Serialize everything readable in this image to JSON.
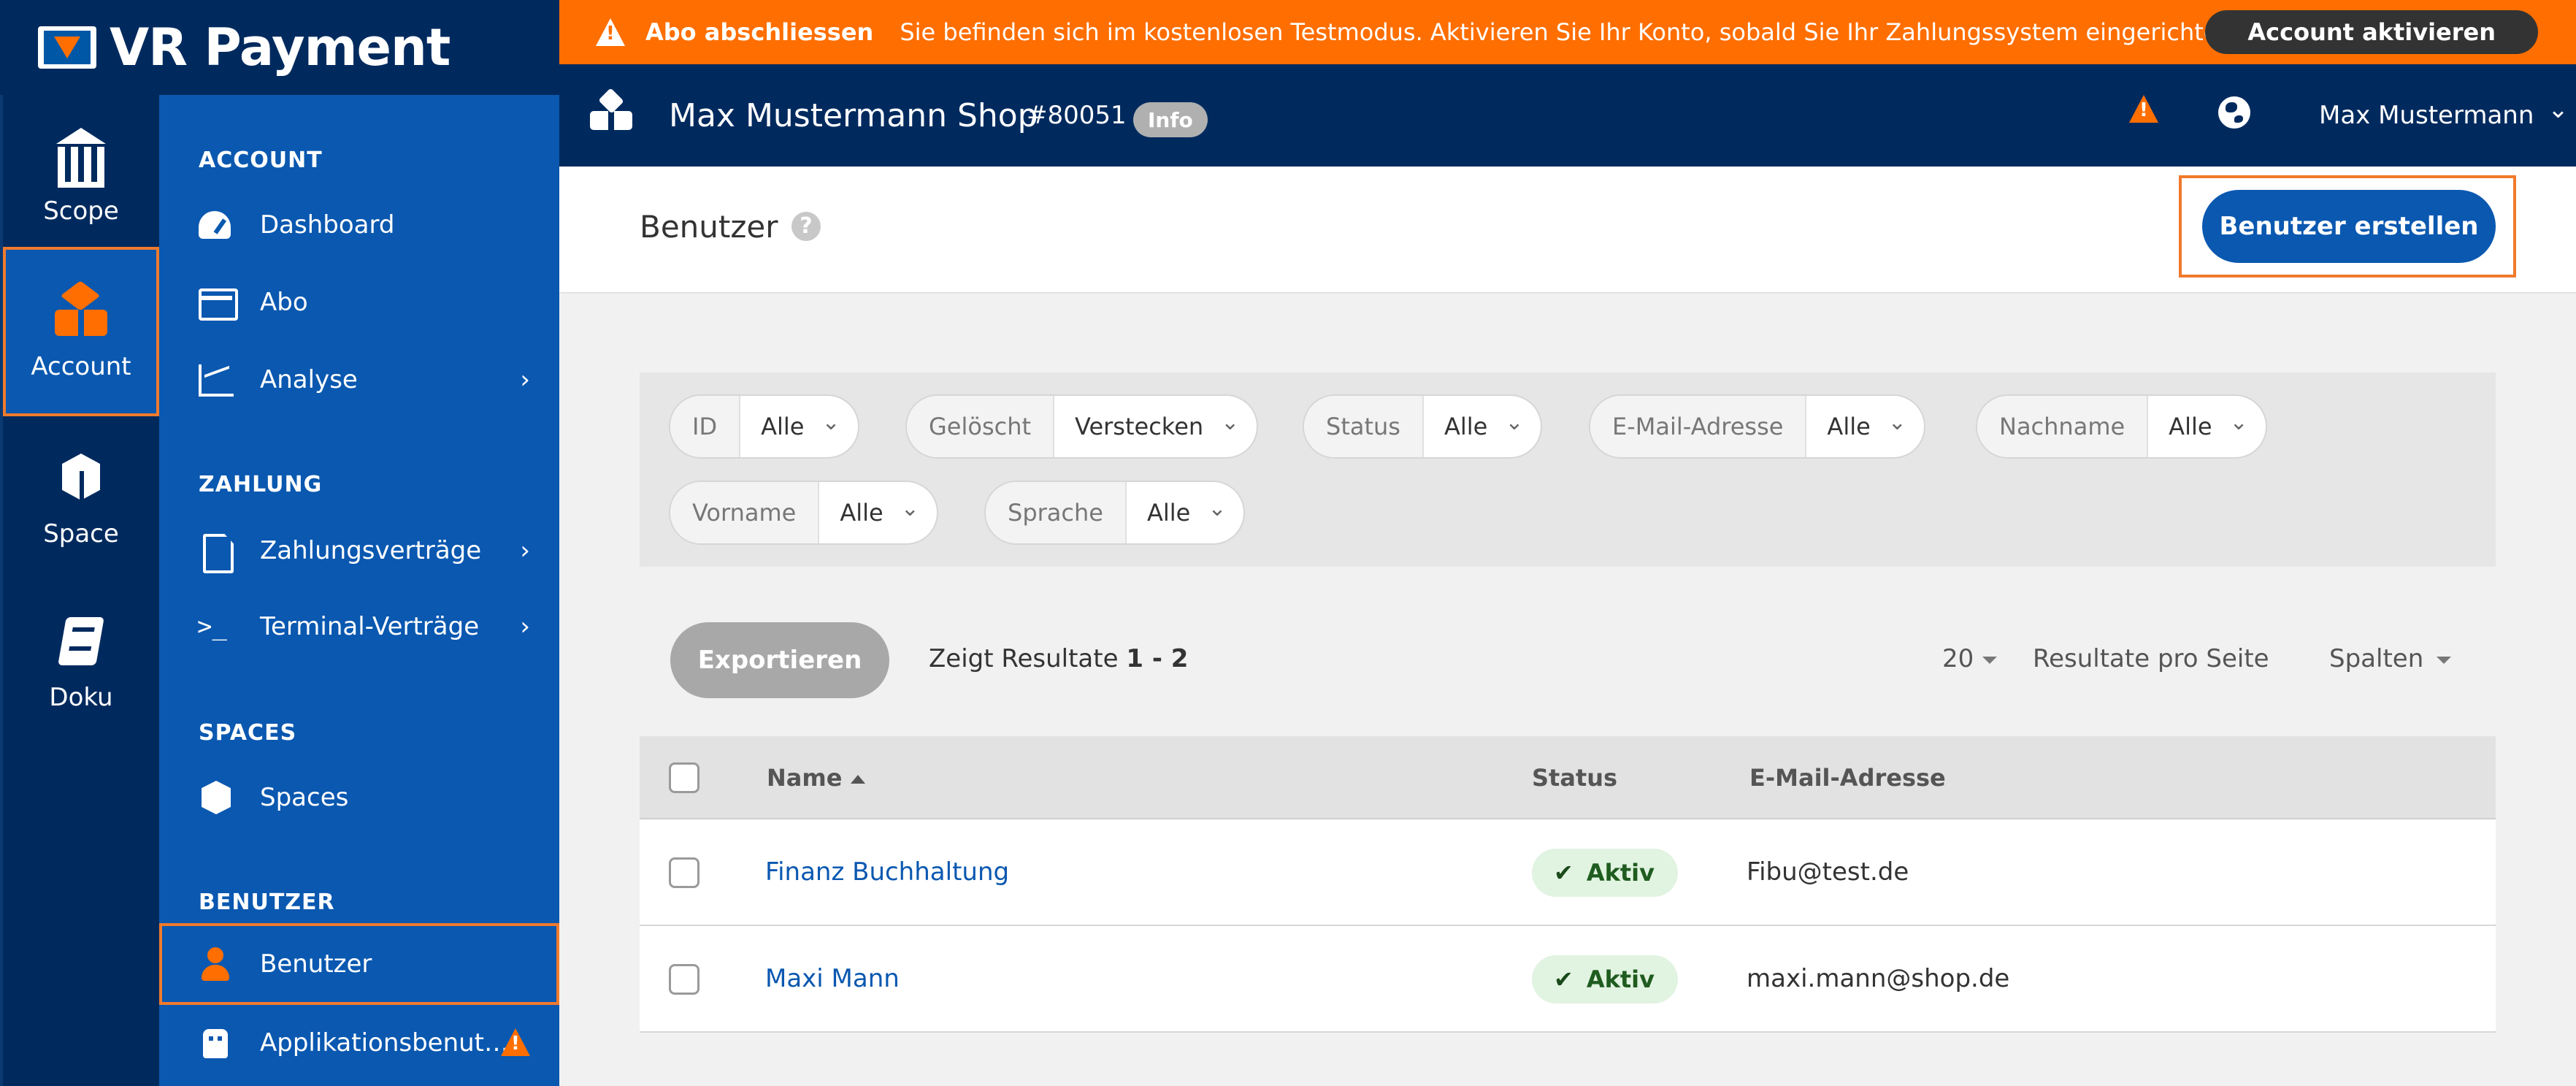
{
  "brand": {
    "name": "VR Payment"
  },
  "rail": [
    {
      "label": "Scope",
      "icon": "bank-icon"
    },
    {
      "label": "Account",
      "icon": "cubes-icon",
      "active": true
    },
    {
      "label": "Space",
      "icon": "cube-icon"
    },
    {
      "label": "Doku",
      "icon": "book-icon"
    }
  ],
  "nav": {
    "account": {
      "heading": "ACCOUNT",
      "items": [
        {
          "label": "Dashboard",
          "icon": "dashboard-icon"
        },
        {
          "label": "Abo",
          "icon": "credit-card-icon"
        },
        {
          "label": "Analyse",
          "icon": "line-chart-icon",
          "chevron": "›"
        }
      ]
    },
    "zahlung": {
      "heading": "ZAHLUNG",
      "items": [
        {
          "label": "Zahlungsverträge",
          "icon": "document-icon",
          "chevron": "›"
        },
        {
          "label": "Terminal-Verträge",
          "icon": "terminal-icon",
          "chevron": "›"
        }
      ]
    },
    "spaces": {
      "heading": "SPACES",
      "items": [
        {
          "label": "Spaces",
          "icon": "cube-icon"
        }
      ]
    },
    "benutzer": {
      "heading": "BENUTZER",
      "items": [
        {
          "label": "Benutzer",
          "icon": "user-icon",
          "active": true
        },
        {
          "label": "Applikationsbenut…",
          "icon": "robot-icon",
          "warning": true
        }
      ]
    }
  },
  "banner": {
    "title": "Abo abschliessen",
    "message": "Sie befinden sich im kostenlosen Testmodus. Aktivieren Sie Ihr Konto, sobald Sie Ihr Zahlungssystem eingerichtet haben...",
    "button": "Account aktivieren",
    "color": "#ff6e00"
  },
  "shop": {
    "name": "Max Mustermann Shop",
    "id": "#80051",
    "badge": "Info",
    "user": "Max Mustermann",
    "user_chevron": "⌄"
  },
  "page": {
    "title": "Benutzer",
    "help": "?",
    "create_button": "Benutzer erstellen"
  },
  "filters": [
    {
      "key": "ID",
      "value": "Alle"
    },
    {
      "key": "Gelöscht",
      "value": "Verstecken"
    },
    {
      "key": "Status",
      "value": "Alle"
    },
    {
      "key": "E-Mail-Adresse",
      "value": "Alle"
    },
    {
      "key": "Nachname",
      "value": "Alle"
    },
    {
      "key": "Vorname",
      "value": "Alle"
    },
    {
      "key": "Sprache",
      "value": "Alle"
    }
  ],
  "toolbar": {
    "export": "Exportieren",
    "results_prefix": "Zeigt Resultate",
    "results_range": "1 - 2",
    "per_page": "20",
    "per_page_label": "Resultate pro Seite",
    "columns": "Spalten"
  },
  "table": {
    "headers": {
      "name": "Name",
      "status": "Status",
      "email": "E-Mail-Adresse"
    },
    "rows": [
      {
        "name": "Finanz Buchhaltung",
        "status": "Aktiv",
        "email": "Fibu@test.de"
      },
      {
        "name": "Maxi Mann",
        "status": "Aktiv",
        "email": "maxi.mann@shop.de"
      }
    ]
  },
  "colors": {
    "rail": "#002a5e",
    "nav": "#0a58b0",
    "accent": "#ff6e00",
    "highlight_frame": "#f07a2d",
    "status_active_bg": "#e1f3e1"
  }
}
